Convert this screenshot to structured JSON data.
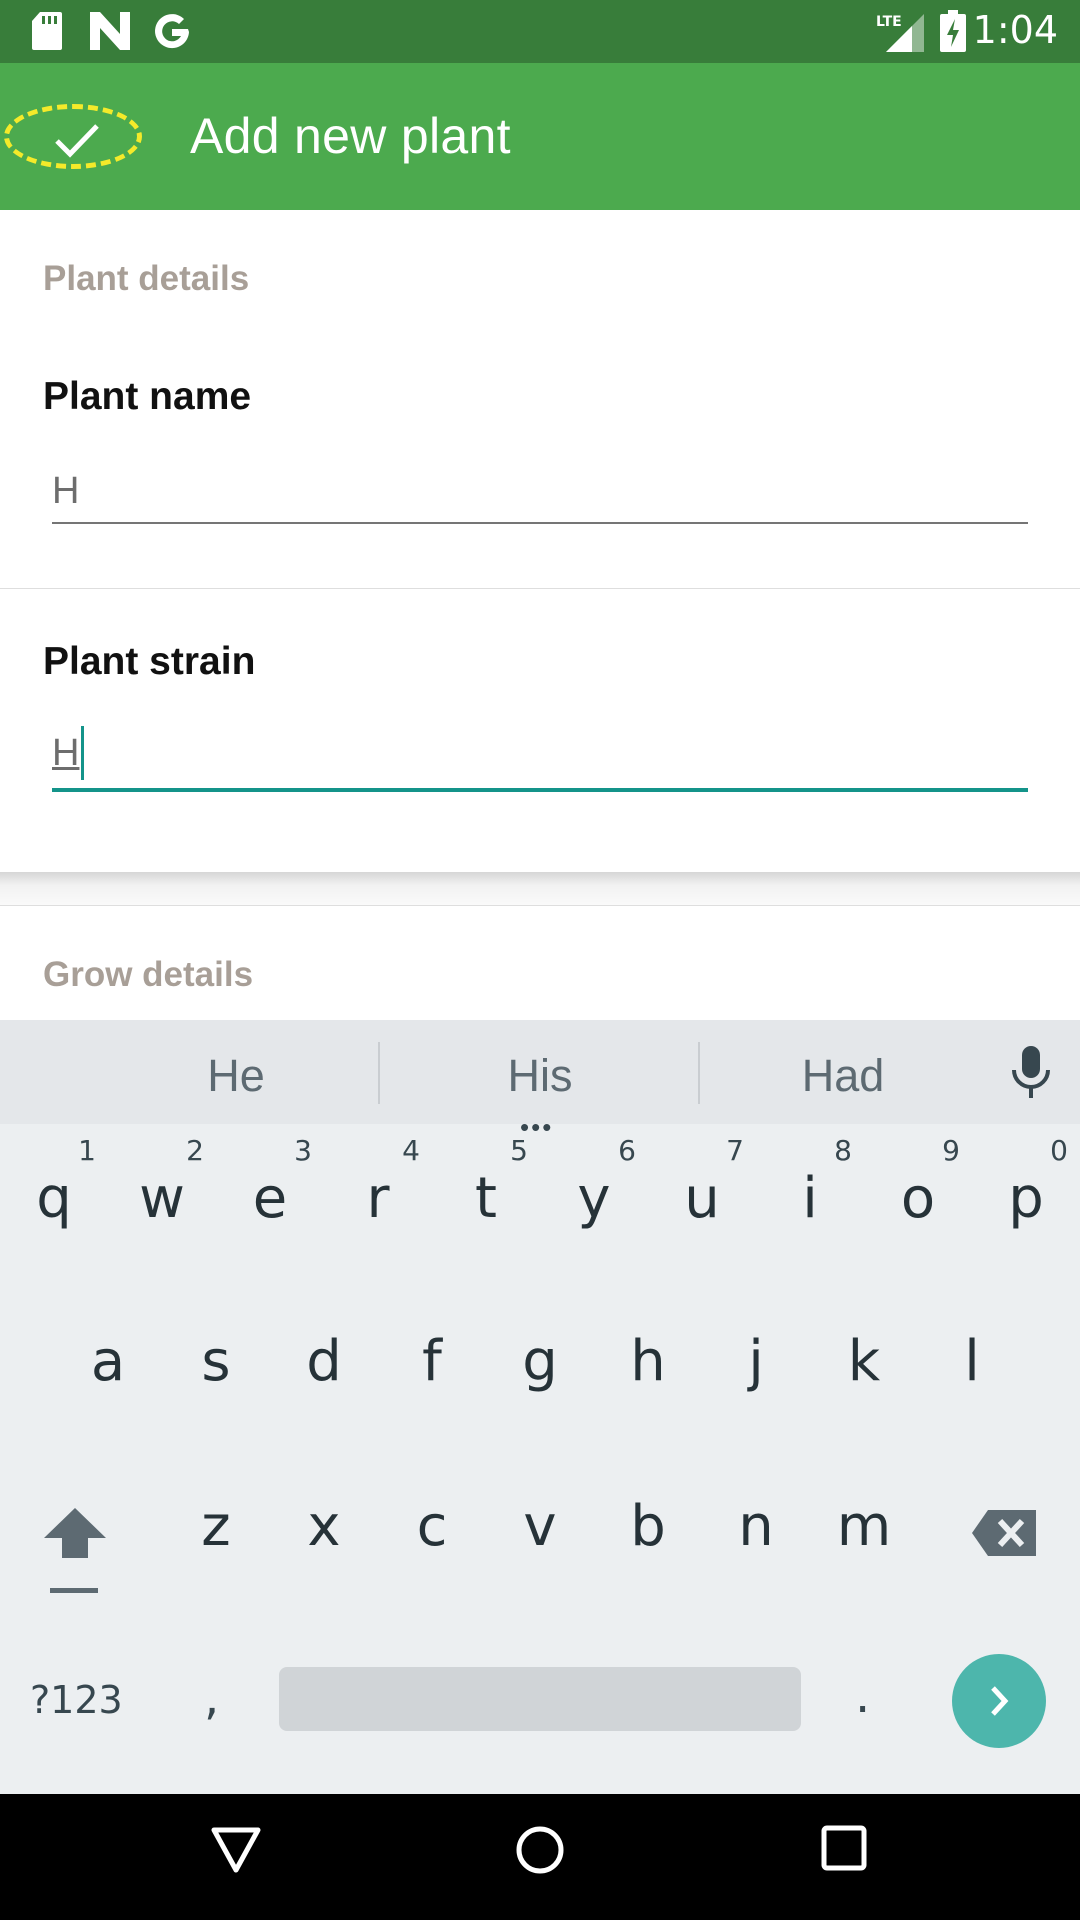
{
  "status_bar": {
    "time": "1:04",
    "network": "LTE",
    "icons": [
      "sd-card-icon",
      "n-logo-icon",
      "google-g-icon",
      "lte-signal-icon",
      "battery-charging-icon"
    ]
  },
  "app_bar": {
    "title": "Add new plant",
    "confirm_icon": "check-icon"
  },
  "form": {
    "plant_details_header": "Plant details",
    "plant_name_label": "Plant name",
    "plant_name_value": "H",
    "plant_strain_label": "Plant strain",
    "plant_strain_value": "H",
    "grow_details_header": "Grow details"
  },
  "keyboard": {
    "suggestions": [
      "He",
      "His",
      "Had"
    ],
    "suggestion_more": "•••",
    "row1": [
      {
        "key": "q",
        "hint": "1"
      },
      {
        "key": "w",
        "hint": "2"
      },
      {
        "key": "e",
        "hint": "3"
      },
      {
        "key": "r",
        "hint": "4"
      },
      {
        "key": "t",
        "hint": "5"
      },
      {
        "key": "y",
        "hint": "6"
      },
      {
        "key": "u",
        "hint": "7"
      },
      {
        "key": "i",
        "hint": "8"
      },
      {
        "key": "o",
        "hint": "9"
      },
      {
        "key": "p",
        "hint": "0"
      }
    ],
    "row2": [
      "a",
      "s",
      "d",
      "f",
      "g",
      "h",
      "j",
      "k",
      "l"
    ],
    "row3": [
      "z",
      "x",
      "c",
      "v",
      "b",
      "n",
      "m"
    ],
    "symbols_label": "?123",
    "comma_label": ",",
    "period_label": ".",
    "icons": [
      "shift-icon",
      "backspace-icon",
      "mic-icon",
      "enter-arrow-icon"
    ]
  },
  "colors": {
    "status_bar": "#387d3a",
    "app_bar": "#4caa4e",
    "accent": "#14948a",
    "confirm_highlight": "#f4ea2a",
    "enter_key": "#4db6ac"
  },
  "nav": {
    "icons": [
      "back-icon",
      "home-icon",
      "recents-icon"
    ]
  }
}
